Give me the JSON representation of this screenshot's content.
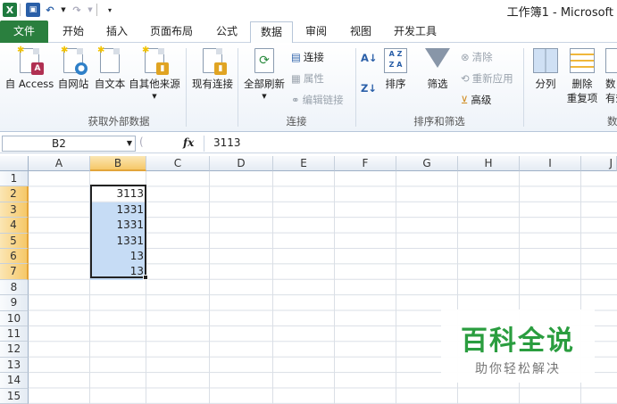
{
  "window": {
    "title": "工作簿1 - Microsoft"
  },
  "tabs": [
    "文件",
    "开始",
    "插入",
    "页面布局",
    "公式",
    "数据",
    "审阅",
    "视图",
    "开发工具"
  ],
  "ribbon": {
    "get_external": {
      "buttons": [
        "自 Access",
        "自网站",
        "自文本",
        "自其他来源",
        "现有连接"
      ],
      "label": "获取外部数据"
    },
    "connections": {
      "refresh_label": "全部刷新",
      "items": [
        "连接",
        "属性",
        "编辑链接"
      ],
      "label": "连接"
    },
    "sort_filter": {
      "sort_label": "排序",
      "filter_label": "筛选",
      "items": [
        "清除",
        "重新应用",
        "高级"
      ],
      "label": "排序和筛选",
      "az": "A Z",
      "za": "Z A"
    },
    "data_tools": {
      "split_label": "分列",
      "remove_dup_line1": "删除",
      "remove_dup_line2": "重复项",
      "partial_1": "数",
      "partial_2": "有效",
      "label": "数"
    }
  },
  "formula_bar": {
    "name_box": "B2",
    "fx": "fx",
    "content": "3113"
  },
  "columns": [
    "A",
    "B",
    "C",
    "D",
    "E",
    "F",
    "G",
    "H",
    "I",
    "J"
  ],
  "rows": [
    "1",
    "2",
    "3",
    "4",
    "5",
    "6",
    "7",
    "8",
    "9",
    "10",
    "11",
    "12",
    "13",
    "14",
    "15"
  ],
  "cells": {
    "B2": "3113",
    "B3": "1331",
    "B4": "1331",
    "B5": "1331",
    "B6": "13",
    "B7": "13"
  },
  "watermark": {
    "title": "百科全说",
    "subtitle": "助你轻松解决"
  },
  "colors": {
    "file_tab": "#2a7f3e",
    "selection_fill": "#c6dcf5",
    "watermark_green": "#2a9d3f"
  }
}
